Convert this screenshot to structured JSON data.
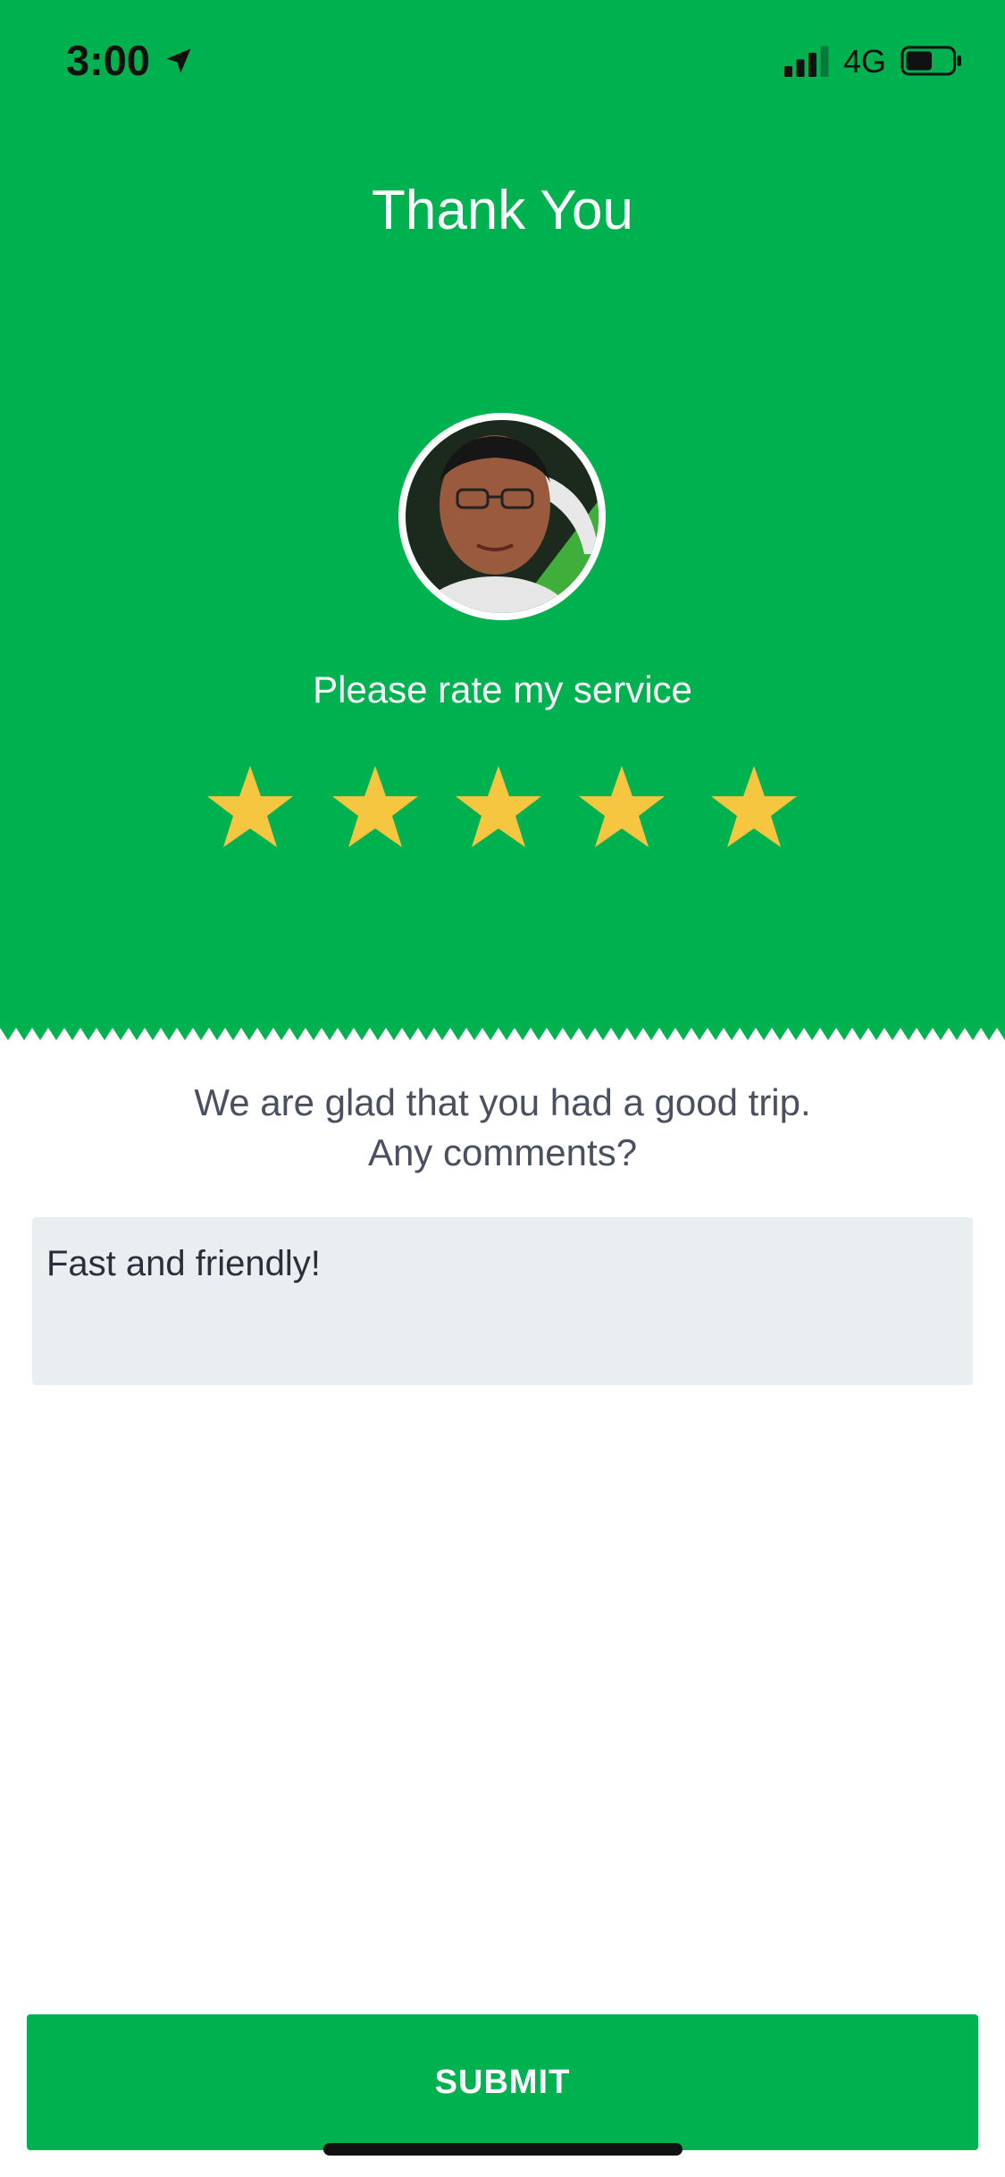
{
  "status_bar": {
    "time": "3:00",
    "network": "4G",
    "icons": [
      "location-arrow-icon",
      "cellular-signal-icon",
      "battery-icon"
    ]
  },
  "header": {
    "title": "Thank You",
    "rate_prompt": "Please rate my service",
    "avatar_icon": "driver-avatar"
  },
  "rating": {
    "selected": 5,
    "max": 5,
    "star_color": "#f7c640"
  },
  "feedback": {
    "line1": "We are glad that you had a good trip.",
    "line2": "Any comments?",
    "comment_value": "Fast and friendly!"
  },
  "actions": {
    "submit_label": "SUBMIT"
  },
  "colors": {
    "brand_green": "#00b14f",
    "input_bg": "#e9eff1",
    "text_gray": "#4a5060"
  }
}
